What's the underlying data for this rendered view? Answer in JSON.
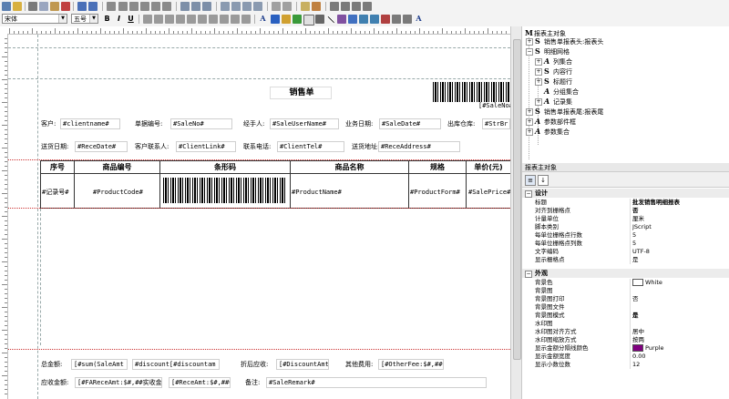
{
  "toolbar": {
    "font_name": "宋体",
    "font_size": "五号",
    "bold": "B",
    "italic": "I",
    "underline": "U",
    "text_tool": "A",
    "text_tool2": "A"
  },
  "report": {
    "title": "销售单",
    "barcode_field": "[#SaleNo#]",
    "header_row1": [
      {
        "label": "客户:",
        "value": "#clientname#"
      },
      {
        "label": "单据编号:",
        "value": "#SaleNo#"
      },
      {
        "label": "经手人:",
        "value": "#SaleUserName#"
      },
      {
        "label": "业务日期:",
        "value": "#SaleDate#"
      },
      {
        "label": "出库仓库:",
        "value": "#StrBr"
      }
    ],
    "header_row2": [
      {
        "label": "送货日期:",
        "value": "#ReceDate#"
      },
      {
        "label": "客户联系人:",
        "value": "#ClientLink#"
      },
      {
        "label": "联系电话:",
        "value": "#ClientTel#"
      },
      {
        "label": "送货地址:",
        "value": "#ReceAddress#"
      }
    ],
    "table_headers": [
      "序号",
      "商品编号",
      "条形码",
      "商品名称",
      "规格",
      "单价(元)"
    ],
    "detail_row": [
      "#记录号#",
      "#ProductCode#",
      "",
      "#ProductName#",
      "#ProductForm#",
      "#SalePrice#"
    ],
    "footer_row1": [
      {
        "label": "总金额:",
        "value": "[#sum(SaleAmt"
      },
      {
        "label": "",
        "value": "#discount[#discountam"
      },
      {
        "label": "折后应收:",
        "value": "[#DiscountAmt:$"
      },
      {
        "label": "其他费用:",
        "value": "[#OtherFee:$#,##0"
      }
    ],
    "footer_row2": [
      {
        "label": "应收金额:",
        "value": "[#FAReceAmt:$#,##实收金额:"
      },
      {
        "label": "",
        "value": "[#ReceAmt:$#,##0."
      },
      {
        "label": "备注:",
        "value": "#SaleRemark#"
      }
    ]
  },
  "tree": {
    "root": "报表主对象",
    "items": [
      {
        "icon": "S",
        "label": "销售单报表头:报表头",
        "level": 1
      },
      {
        "icon": "S",
        "label": "明细网格",
        "level": 1
      },
      {
        "icon": "A",
        "label": "列集合",
        "level": 2
      },
      {
        "icon": "S",
        "label": "内容行",
        "level": 2
      },
      {
        "icon": "S",
        "label": "标题行",
        "level": 2
      },
      {
        "icon": "A",
        "label": "分组集合",
        "level": 2
      },
      {
        "icon": "A",
        "label": "记录集",
        "level": 2
      },
      {
        "icon": "S",
        "label": "销售单报表尾:报表尾",
        "level": 1
      },
      {
        "icon": "A",
        "label": "参数部件框",
        "level": 1
      },
      {
        "icon": "A",
        "label": "参数集合",
        "level": 1
      }
    ]
  },
  "properties": {
    "title": "报表主对象",
    "groups": [
      {
        "name": "设计",
        "rows": [
          {
            "key": "标题",
            "value": "批发销售明细报表",
            "bold": true
          },
          {
            "key": "对齐到栅格点",
            "value": "否",
            "bold": true
          },
          {
            "key": "计量单位",
            "value": "厘米"
          },
          {
            "key": "脚本类别",
            "value": "JScript"
          },
          {
            "key": "每单位栅格点行数",
            "value": "5"
          },
          {
            "key": "每单位栅格点列数",
            "value": "5"
          },
          {
            "key": "文字编码",
            "value": "UTF-8"
          },
          {
            "key": "显示栅格点",
            "value": "是"
          }
        ]
      },
      {
        "name": "外观",
        "rows": [
          {
            "key": "背景色",
            "value": "White",
            "swatch": "#ffffff"
          },
          {
            "key": "背景图",
            "value": ""
          },
          {
            "key": "背景图打印",
            "value": "否"
          },
          {
            "key": "背景图文件",
            "value": ""
          },
          {
            "key": "背景图模式",
            "value": "是",
            "bold": true
          },
          {
            "key": "水印图",
            "value": ""
          },
          {
            "key": "水印图对齐方式",
            "value": "居中"
          },
          {
            "key": "水印图缩放方式",
            "value": "按两"
          },
          {
            "key": "显示金额分隔线颜色",
            "value": "Purple",
            "swatch": "#800080"
          },
          {
            "key": "显示金额宽度",
            "value": "0.00"
          },
          {
            "key": "显示小数位数",
            "value": "12"
          }
        ]
      }
    ]
  }
}
